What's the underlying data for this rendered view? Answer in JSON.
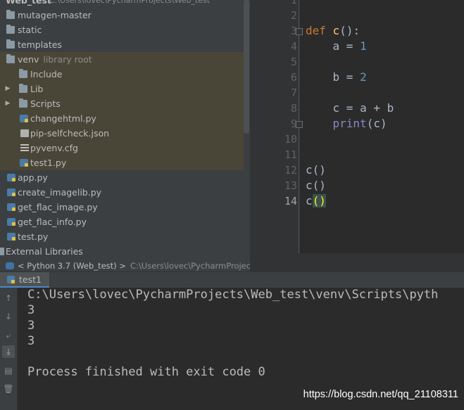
{
  "project_tree": {
    "header_title": "Web_test",
    "header_path": "C:\\Users\\lovec\\PycharmProjects\\Web_test",
    "items": [
      {
        "label": "mutagen-master",
        "hint": "",
        "icon": "folder-icon"
      },
      {
        "label": "static",
        "hint": "",
        "icon": "folder-icon"
      },
      {
        "label": "templates",
        "hint": "",
        "icon": "folder-icon"
      },
      {
        "label": "venv",
        "hint": "library root",
        "icon": "folder-icon"
      },
      {
        "label": "Include",
        "hint": "",
        "icon": "folder-icon"
      },
      {
        "label": "Lib",
        "hint": "",
        "icon": "folder-icon"
      },
      {
        "label": "Scripts",
        "hint": "",
        "icon": "folder-icon"
      },
      {
        "label": "changehtml.py",
        "hint": "",
        "icon": "python-file-icon"
      },
      {
        "label": "pip-selfcheck.json",
        "hint": "",
        "icon": "json-file-icon"
      },
      {
        "label": "pyvenv.cfg",
        "hint": "",
        "icon": "config-file-icon"
      },
      {
        "label": "test1.py",
        "hint": "",
        "icon": "python-file-icon"
      },
      {
        "label": "app.py",
        "hint": "",
        "icon": "python-file-icon"
      },
      {
        "label": "create_imagelib.py",
        "hint": "",
        "icon": "python-file-icon"
      },
      {
        "label": "get_flac_image.py",
        "hint": "",
        "icon": "python-file-icon"
      },
      {
        "label": "get_flac_info.py",
        "hint": "",
        "icon": "python-file-icon"
      },
      {
        "label": "test.py",
        "hint": "",
        "icon": "python-file-icon"
      },
      {
        "label": "External Libraries",
        "hint": "",
        "icon": "library-icon"
      },
      {
        "label": "< Python 3.7 (Web_test) >",
        "hint": "C:\\Users\\lovec\\PycharmProjec",
        "icon": "python-sdk-icon"
      }
    ]
  },
  "editor": {
    "line_numbers": [
      "1",
      "2",
      "3",
      "4",
      "5",
      "6",
      "7",
      "8",
      "9",
      "10",
      "11",
      "12",
      "13",
      "14"
    ],
    "current_line": "14",
    "code": {
      "l3_kw": "def",
      "l3_fn": "c",
      "l3_rest": "():",
      "l4_a": "    a = ",
      "l4_num": "1",
      "l6_b": "    b = ",
      "l6_num": "2",
      "l8": "    c = a + b",
      "l9_pad": "    ",
      "l9_bi": "print",
      "l9_rest": "(c)",
      "l12": "c()",
      "l13": "c()",
      "l14_c": "c",
      "l14_parens": "()"
    }
  },
  "run_panel": {
    "tab_label": "test1",
    "console_lines": [
      "C:\\Users\\lovec\\PycharmProjects\\Web_test\\venv\\Scripts\\pyth",
      "3",
      "3",
      "3",
      "",
      "Process finished with exit code 0"
    ]
  },
  "watermark": "https://blog.csdn.net/qq_21108311",
  "colors": {
    "keyword": "#cc7832",
    "function": "#ffc66d",
    "number": "#6897bb",
    "builtin": "#8888c6",
    "venv_highlight": "#4a4637"
  }
}
